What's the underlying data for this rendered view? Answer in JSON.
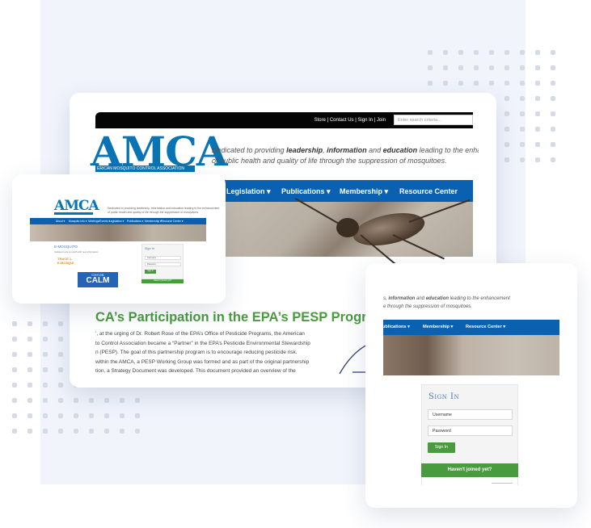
{
  "colors": {
    "brand_blue": "#0a61b1",
    "logo_blue": "#0a73b3",
    "green": "#4a9b3f",
    "orange": "#e58a1d",
    "panel": "#f1f4fb"
  },
  "main": {
    "toplinks": "Store | Contact Us | Sign In | Join",
    "search_placeholder": "Enter search criteria...",
    "logo": "AMCA",
    "logo_strip": "ERICAN MOSQUITO CONTROL ASSOCIATION",
    "tagline_line1_pre": "Dedicated to providing ",
    "tagline_b1": "leadership",
    "tagline_sep1": ", ",
    "tagline_b2": "information",
    "tagline_and": " and ",
    "tagline_b3": "education",
    "tagline_line1_post": " leading to the enhancem",
    "tagline_line2": "of public health and quality of life through the suppression of mosquitoes.",
    "nav": [
      "s ▾",
      "Legislation ▾",
      "Publications ▾",
      "Membership ▾",
      "Resource Center"
    ],
    "heading": "CA’s Participation in the EPA’s PESP Program",
    "body": [
      "’, at the urging of Dr. Robert Rose of the EPA’s Office of Pesticide Programs, the American",
      "to Control Association became a “Partner” in the EPA’s Pesticide Environmental Stewardship",
      "n (PESP). The goal of this partnership program is to encourage reducing pesticide risk.",
      "within the AMCA, a PESP Working Group was formed and as part of the original partnership",
      "tion, a Strategy Document was developed. This document provided an overview of the"
    ]
  },
  "small": {
    "logo": "AMCA",
    "tagline1": "Dedicated to providing leadership, information and education leading to the enhancement",
    "tagline2": "of public health and quality of life through the suppression of mosquitoes.",
    "nav": [
      "About ▾",
      "Mosquito Info ▾",
      "Meetings/Events ▾",
      "Legislation ▾",
      "Publications ▾",
      "Membership ▾",
      "Resource Center ▾"
    ],
    "title": "E-MOSQUITO",
    "body": "Updated once a month with new information",
    "orange1": "TRACE 1-",
    "orange2": "E-MOSQUI",
    "calm_small": "CHASE",
    "calm_big": "CALM",
    "sign_title": "Sign In",
    "username": "Username",
    "password": "Password",
    "sign_button": "Sign In",
    "joined": "Haven't joined yet?"
  },
  "signin": {
    "tagline1_pre": "s, ",
    "tagline1_b1": "information",
    "tagline1_and": " and ",
    "tagline1_b2": "education",
    "tagline1_post": " leading to the enhancement",
    "tagline2": "e through the suppression of mosquitoes.",
    "nav": [
      "ublications ▾",
      "Membership ▾",
      "Resource Center ▾"
    ],
    "title": "Sign In",
    "username": "Username",
    "password": "Password",
    "button": "Sign In",
    "joined": "Haven't joined yet?"
  }
}
